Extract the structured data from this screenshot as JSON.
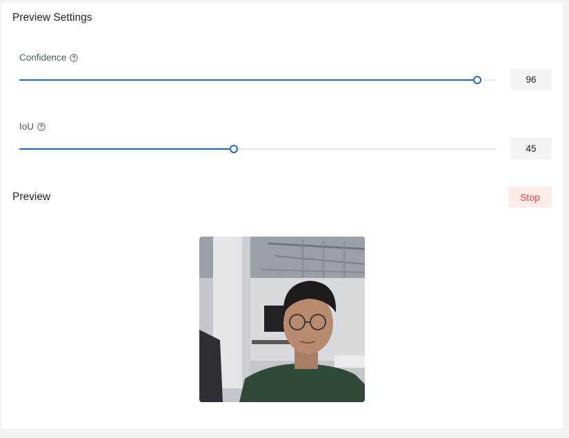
{
  "settings": {
    "title": "Preview Settings",
    "confidence": {
      "label": "Confidence",
      "value": "96",
      "min": 0,
      "max": 100,
      "percent": 96
    },
    "iou": {
      "label": "IoU",
      "value": "45",
      "min": 0,
      "max": 100,
      "percent": 45
    }
  },
  "preview": {
    "title": "Preview",
    "stop_label": "Stop",
    "image_icon": "camera-feed-image"
  },
  "colors": {
    "accent": "#1664d8",
    "track": "#e5e6eb",
    "stop_text": "#f53f3f",
    "stop_bg": "#ffece8"
  }
}
